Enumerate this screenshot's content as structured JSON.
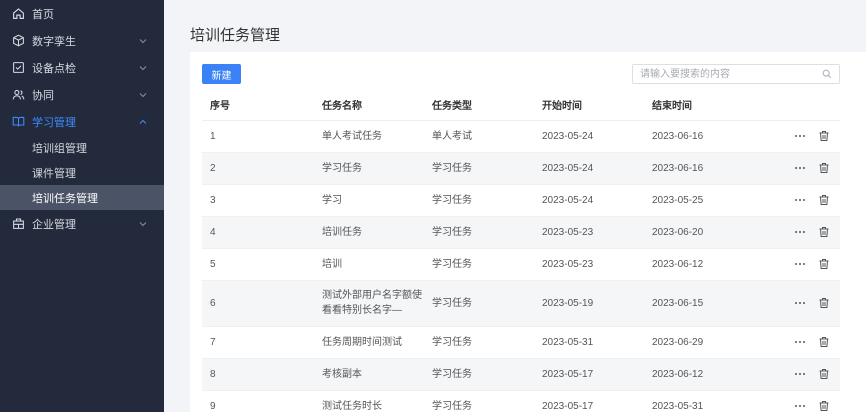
{
  "sidebar": {
    "items": [
      {
        "label": "首页",
        "icon": "home-icon",
        "has_chevron": false
      },
      {
        "label": "数字孪生",
        "icon": "cube-icon",
        "has_chevron": true
      },
      {
        "label": "设备点检",
        "icon": "checkbox-icon",
        "has_chevron": true
      },
      {
        "label": "协同",
        "icon": "users-icon",
        "has_chevron": true
      },
      {
        "label": "学习管理",
        "icon": "book-icon",
        "has_chevron": true,
        "expanded": true
      },
      {
        "label": "企业管理",
        "icon": "building-icon",
        "has_chevron": true
      }
    ],
    "sub_items": [
      {
        "label": "培训组管理"
      },
      {
        "label": "课件管理"
      },
      {
        "label": "培训任务管理",
        "selected": true
      }
    ]
  },
  "main": {
    "title": "培训任务管理",
    "new_button": "新建",
    "search_placeholder": "请输入要搜索的内容"
  },
  "table": {
    "columns": [
      "序号",
      "任务名称",
      "任务类型",
      "开始时间",
      "结束时间"
    ],
    "rows": [
      {
        "no": "1",
        "name": "单人考试任务",
        "type": "单人考试",
        "start": "2023-05-24",
        "end": "2023-06-16"
      },
      {
        "no": "2",
        "name": "学习任务",
        "type": "学习任务",
        "start": "2023-05-24",
        "end": "2023-06-16"
      },
      {
        "no": "3",
        "name": "学习",
        "type": "学习任务",
        "start": "2023-05-24",
        "end": "2023-05-25"
      },
      {
        "no": "4",
        "name": "培训任务",
        "type": "学习任务",
        "start": "2023-05-23",
        "end": "2023-06-20"
      },
      {
        "no": "5",
        "name": "培训",
        "type": "学习任务",
        "start": "2023-05-23",
        "end": "2023-06-12"
      },
      {
        "no": "6",
        "name": "测试外部用户名字额使看看特别长名字—",
        "type": "学习任务",
        "start": "2023-05-19",
        "end": "2023-06-15"
      },
      {
        "no": "7",
        "name": "任务周期时间测试",
        "type": "学习任务",
        "start": "2023-05-31",
        "end": "2023-06-29"
      },
      {
        "no": "8",
        "name": "考核副本",
        "type": "学习任务",
        "start": "2023-05-17",
        "end": "2023-06-12"
      },
      {
        "no": "9",
        "name": "测试任务时长",
        "type": "学习任务",
        "start": "2023-05-17",
        "end": "2023-05-31"
      }
    ]
  },
  "colors": {
    "sidebar_bg": "#232a3b",
    "accent": "#3b82f6",
    "active_menu": "#3d8bff",
    "selected_sub_bg": "#4b5466"
  }
}
